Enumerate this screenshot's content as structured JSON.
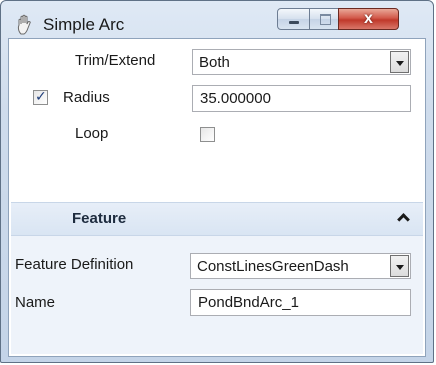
{
  "window": {
    "title": "Simple Arc",
    "close_glyph": "x"
  },
  "settings": {
    "trim_extend": {
      "label": "Trim/Extend",
      "value": "Both"
    },
    "radius": {
      "label": "Radius",
      "checked": true,
      "value": "35.000000"
    },
    "loop": {
      "label": "Loop",
      "checked": false
    }
  },
  "feature": {
    "header": "Feature",
    "definition": {
      "label": "Feature Definition",
      "value": "ConstLinesGreenDash"
    },
    "name": {
      "label": "Name",
      "value": "PondBndArc_1"
    }
  },
  "colors": {
    "accent": "#c0392b",
    "header_bg": "#d9e5f3"
  }
}
